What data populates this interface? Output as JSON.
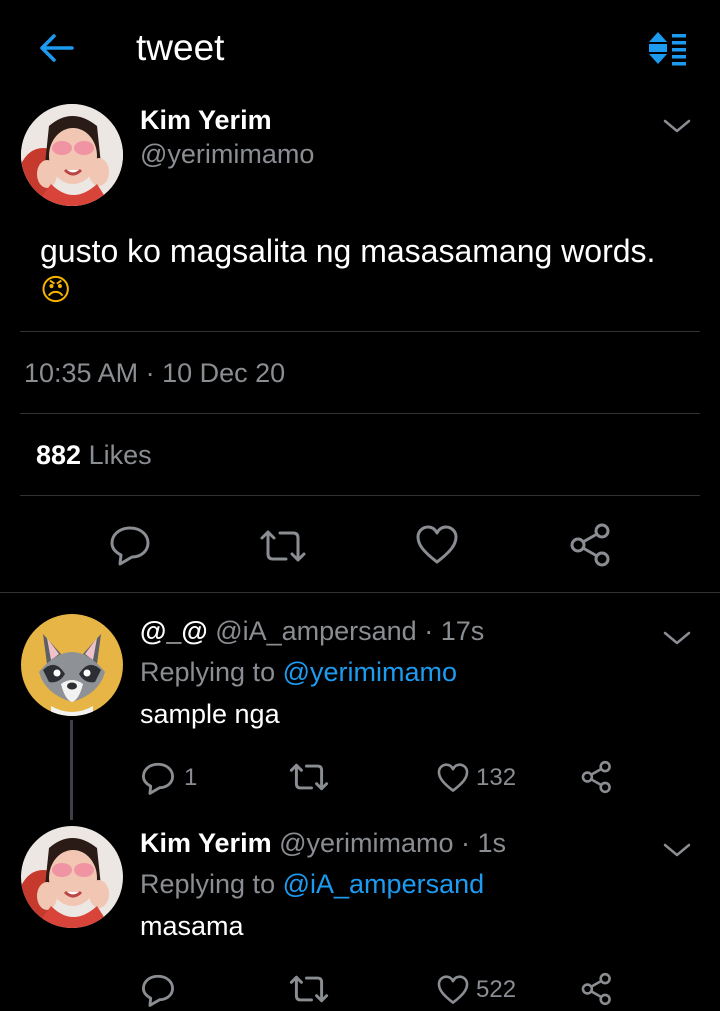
{
  "header": {
    "title": "tweet",
    "back_icon": "arrow-left-icon",
    "sort_icon": "sort-list-icon",
    "accent": "#1d9bf0"
  },
  "main_tweet": {
    "name": "Kim Yerim",
    "handle": "@yerimimamo",
    "text": "gusto ko magsalita ng masasamang words.",
    "emoji": "😠",
    "timestamp": "10:35 AM · 10 Dec 20",
    "likes_count": "882",
    "likes_label": "Likes",
    "avatar_icon": "user-photo-avatar"
  },
  "replies": [
    {
      "name": "@_@",
      "handle": "@iA_ampersand",
      "time": "· 17s",
      "replying_label": "Replying to",
      "replying_to": "@yerimimamo",
      "text": "sample nga",
      "reply_count": "1",
      "like_count": "132",
      "avatar_icon": "raccoon-avatar"
    },
    {
      "name": "Kim Yerim",
      "handle": "@yerimimamo",
      "time": "· 1s",
      "replying_label": "Replying to",
      "replying_to": "@iA_ampersand",
      "text": "masama",
      "reply_count": "",
      "like_count": "522",
      "avatar_icon": "user-photo-avatar"
    }
  ]
}
